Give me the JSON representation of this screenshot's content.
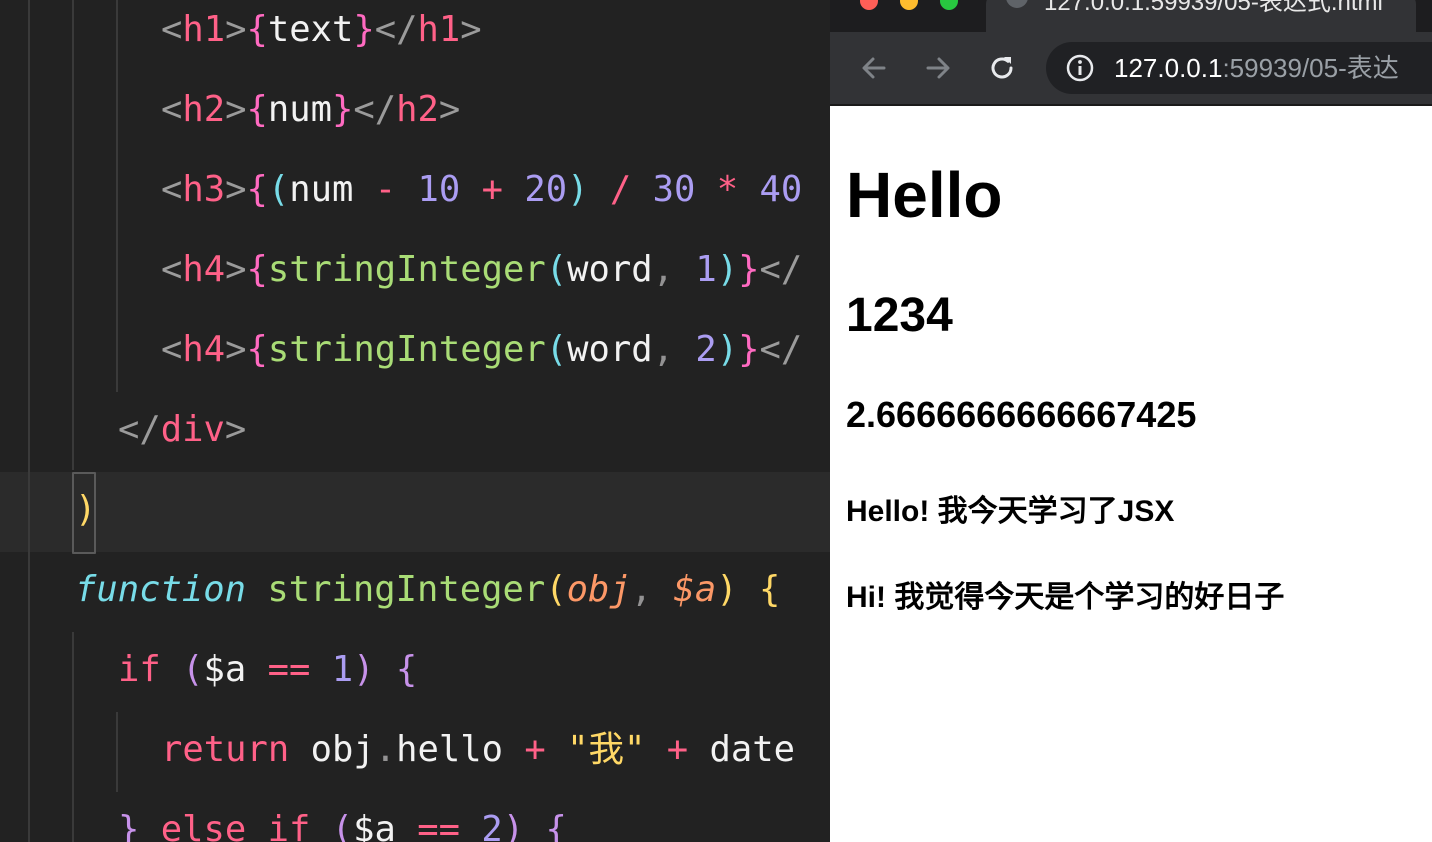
{
  "editor": {
    "lines": [
      {
        "indent": "    ",
        "tokens": [
          [
            "c-punc",
            "<"
          ],
          [
            "c-tag",
            "h1"
          ],
          [
            "c-punc",
            ">"
          ],
          [
            "c-brace",
            "{"
          ],
          [
            "c-id",
            "text"
          ],
          [
            "c-brace",
            "}"
          ],
          [
            "c-punc",
            "</"
          ],
          [
            "c-tag",
            "h1"
          ],
          [
            "c-punc",
            ">"
          ]
        ]
      },
      {
        "indent": "    ",
        "tokens": [
          [
            "c-punc",
            "<"
          ],
          [
            "c-tag",
            "h2"
          ],
          [
            "c-punc",
            ">"
          ],
          [
            "c-brace",
            "{"
          ],
          [
            "c-id",
            "num"
          ],
          [
            "c-brace",
            "}"
          ],
          [
            "c-punc",
            "</"
          ],
          [
            "c-tag",
            "h2"
          ],
          [
            "c-punc",
            ">"
          ]
        ]
      },
      {
        "indent": "    ",
        "tokens": [
          [
            "c-punc",
            "<"
          ],
          [
            "c-tag",
            "h3"
          ],
          [
            "c-punc",
            ">"
          ],
          [
            "c-brace",
            "{"
          ],
          [
            "c-paren-b",
            "("
          ],
          [
            "c-id",
            "num "
          ],
          [
            "c-op",
            "-"
          ],
          [
            "c-id",
            " "
          ],
          [
            "c-num",
            "10"
          ],
          [
            "c-id",
            " "
          ],
          [
            "c-op",
            "+"
          ],
          [
            "c-id",
            " "
          ],
          [
            "c-num",
            "20"
          ],
          [
            "c-paren-b",
            ")"
          ],
          [
            "c-id",
            " "
          ],
          [
            "c-op",
            "/"
          ],
          [
            "c-id",
            " "
          ],
          [
            "c-num",
            "30"
          ],
          [
            "c-id",
            " "
          ],
          [
            "c-op",
            "*"
          ],
          [
            "c-id",
            " "
          ],
          [
            "c-num",
            "40"
          ]
        ]
      },
      {
        "indent": "    ",
        "tokens": [
          [
            "c-punc",
            "<"
          ],
          [
            "c-tag",
            "h4"
          ],
          [
            "c-punc",
            ">"
          ],
          [
            "c-brace",
            "{"
          ],
          [
            "c-fn",
            "stringInteger"
          ],
          [
            "c-paren-b",
            "("
          ],
          [
            "c-id",
            "word"
          ],
          [
            "c-dim",
            ", "
          ],
          [
            "c-num",
            "1"
          ],
          [
            "c-paren-b",
            ")"
          ],
          [
            "c-brace",
            "}"
          ],
          [
            "c-punc",
            "</"
          ]
        ]
      },
      {
        "indent": "    ",
        "tokens": [
          [
            "c-punc",
            "<"
          ],
          [
            "c-tag",
            "h4"
          ],
          [
            "c-punc",
            ">"
          ],
          [
            "c-brace",
            "{"
          ],
          [
            "c-fn",
            "stringInteger"
          ],
          [
            "c-paren-b",
            "("
          ],
          [
            "c-id",
            "word"
          ],
          [
            "c-dim",
            ", "
          ],
          [
            "c-num",
            "2"
          ],
          [
            "c-paren-b",
            ")"
          ],
          [
            "c-brace",
            "}"
          ],
          [
            "c-punc",
            "</"
          ]
        ]
      },
      {
        "indent": "  ",
        "tokens": [
          [
            "c-punc",
            "</"
          ],
          [
            "c-tag",
            "div"
          ],
          [
            "c-punc",
            ">"
          ]
        ]
      },
      {
        "indent": "",
        "tokens": [
          [
            "c-paren-y",
            ")"
          ]
        ]
      },
      {
        "indent": "",
        "tokens": [
          [
            "c-fkw",
            "function"
          ],
          [
            "c-id",
            " "
          ],
          [
            "c-fn",
            "stringInteger"
          ],
          [
            "c-paren-y",
            "("
          ],
          [
            "c-param",
            "obj"
          ],
          [
            "c-dim",
            ", "
          ],
          [
            "c-param",
            "$a"
          ],
          [
            "c-paren-y",
            ")"
          ],
          [
            "c-id",
            " "
          ],
          [
            "c-paren-y",
            "{"
          ]
        ]
      },
      {
        "indent": "  ",
        "tokens": [
          [
            "c-kw",
            "if"
          ],
          [
            "c-id",
            " "
          ],
          [
            "c-paren-p",
            "("
          ],
          [
            "c-id",
            "$a "
          ],
          [
            "c-op",
            "=="
          ],
          [
            "c-id",
            " "
          ],
          [
            "c-num",
            "1"
          ],
          [
            "c-paren-p",
            ")"
          ],
          [
            "c-id",
            " "
          ],
          [
            "c-paren-p",
            "{"
          ]
        ]
      },
      {
        "indent": "    ",
        "tokens": [
          [
            "c-kw",
            "return"
          ],
          [
            "c-id",
            " obj"
          ],
          [
            "c-dim",
            "."
          ],
          [
            "c-id",
            "hello "
          ],
          [
            "c-op",
            "+"
          ],
          [
            "c-id",
            " "
          ],
          [
            "c-str",
            "\"我\""
          ],
          [
            "c-id",
            " "
          ],
          [
            "c-op",
            "+"
          ],
          [
            "c-id",
            " date"
          ]
        ]
      },
      {
        "indent": "  ",
        "tokens": [
          [
            "c-paren-p",
            "}"
          ],
          [
            "c-id",
            " "
          ],
          [
            "c-kw",
            "else"
          ],
          [
            "c-id",
            " "
          ],
          [
            "c-kw",
            "if"
          ],
          [
            "c-id",
            " "
          ],
          [
            "c-paren-p",
            "("
          ],
          [
            "c-id",
            "$a "
          ],
          [
            "c-op",
            "=="
          ],
          [
            "c-id",
            " "
          ],
          [
            "c-num",
            "2"
          ],
          [
            "c-paren-p",
            ")"
          ],
          [
            "c-id",
            " "
          ],
          [
            "c-paren-p",
            "{"
          ]
        ]
      }
    ]
  },
  "browser": {
    "tab_title": "127.0.0.1:59939/05-表达式.html",
    "url_host": "127.0.0.1",
    "url_path": ":59939/05-表达",
    "colors": {
      "red": "#ff5f57",
      "yellow": "#febc2e",
      "green": "#28c840"
    }
  },
  "page": {
    "h1": "Hello",
    "h2": "1234",
    "h3": "2.6666666666667425",
    "h4_first": "Hello! 我今天学习了JSX",
    "h4_second": "Hi! 我觉得今天是个学习的好日子"
  }
}
